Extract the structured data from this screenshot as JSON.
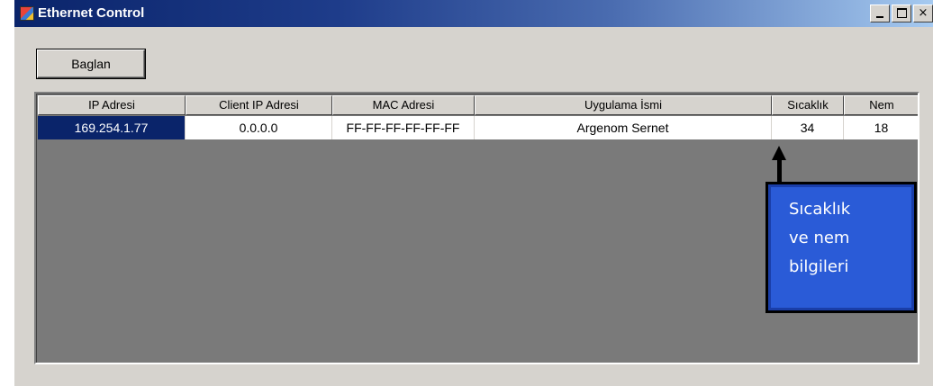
{
  "window": {
    "title": "Ethernet Control",
    "controls": {
      "minimize": "",
      "maximize": "",
      "close": "×"
    }
  },
  "toolbar": {
    "connect_label": "Baglan"
  },
  "table": {
    "columns": [
      "IP Adresi",
      "Client IP Adresi",
      "MAC Adresi",
      "Uygulama İsmi",
      "Sıcaklık",
      "Nem"
    ],
    "rows": [
      [
        "169.254.1.77",
        "0.0.0.0",
        "FF-FF-FF-FF-FF-FF",
        "Argenom Sernet",
        "34",
        "18"
      ]
    ]
  },
  "annotation": {
    "lines": [
      "Sıcaklık",
      "ve nem",
      "bilgileri"
    ]
  },
  "colors": {
    "selection": "#0a246a",
    "callout": "#2a5bd7",
    "list_background": "#7a7a7a"
  }
}
